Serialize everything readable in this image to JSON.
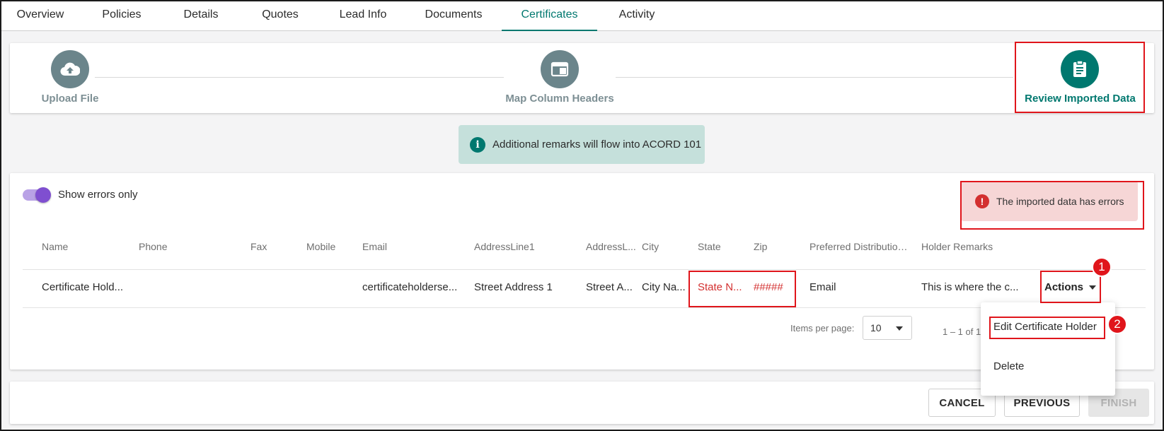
{
  "tabs": [
    "Overview",
    "Policies",
    "Details",
    "Quotes",
    "Lead Info",
    "Documents",
    "Certificates",
    "Activity"
  ],
  "active_tab": "Certificates",
  "stepper": {
    "steps": [
      {
        "label": "Upload File",
        "icon": "cloud-upload-icon"
      },
      {
        "label": "Map Column Headers",
        "icon": "window-icon"
      },
      {
        "label": "Review Imported Data",
        "icon": "clipboard-icon"
      }
    ],
    "active_step": "Review Imported Data"
  },
  "info_banner": {
    "text": "Additional remarks will flow into ACORD 101",
    "icon": "info-icon"
  },
  "toggle": {
    "label": "Show errors only",
    "state": "on"
  },
  "error_alert": {
    "text": "The imported data has errors",
    "icon": "error-icon"
  },
  "table": {
    "headers": [
      "Name",
      "Phone",
      "Fax",
      "Mobile",
      "Email",
      "AddressLine1",
      "AddressL...",
      "City",
      "State",
      "Zip",
      "Preferred Distribution ...",
      "Holder Remarks"
    ],
    "rows": [
      {
        "name": "Certificate Hold...",
        "phone": "",
        "fax": "",
        "mobile": "",
        "email": "certificateholderse...",
        "address1": "Street Address 1",
        "address2": "Street A...",
        "city": "City Na...",
        "state": "State N...",
        "zip": "#####",
        "distribution": "Email",
        "remarks": "This is where the c...",
        "actions_label": "Actions"
      }
    ]
  },
  "paginator": {
    "label": "Items per page:",
    "page_size": "10",
    "range": "1 – 1 of 1"
  },
  "actions_menu": {
    "items": [
      "Edit Certificate Holder",
      "Delete"
    ]
  },
  "buttons": {
    "cancel": "CANCEL",
    "previous": "PREVIOUS",
    "finish": "FINISH"
  },
  "annotations": {
    "badge_1": "1",
    "badge_2": "2"
  },
  "colors": {
    "accent": "#00786f",
    "error": "#d32f2f",
    "toggle": "#7f4fd0",
    "annotation": "#e0151b"
  }
}
